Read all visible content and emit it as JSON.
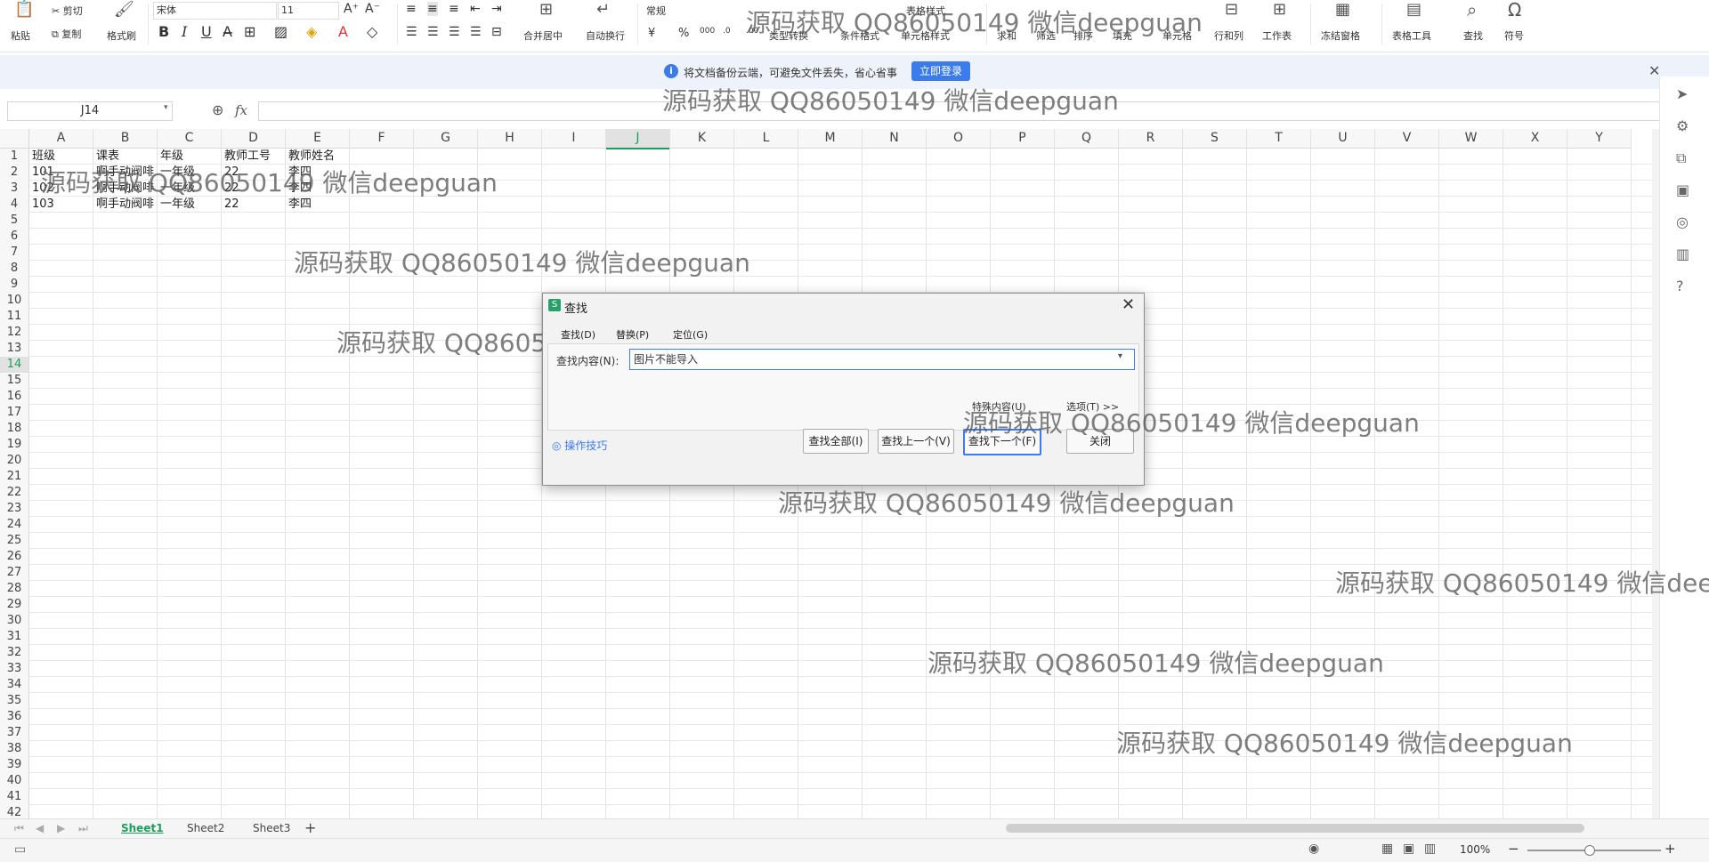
{
  "ribbon": {
    "paste": "粘贴",
    "cut": "剪切",
    "copy": "复制",
    "format_painter": "格式刷",
    "font_name": "宋体",
    "font_size": "11",
    "bold": "B",
    "italic": "I",
    "underline": "U",
    "merge_center": "合并居中",
    "wrap_text": "自动换行",
    "number_format": "常规",
    "currency": "¥",
    "percent": "%",
    "thousands": "000",
    "type_convert": "类型转换",
    "conditional_format": "条件格式",
    "table_style": "表格样式",
    "cell_style": "单元格样式",
    "sum": "求和",
    "filter": "筛选",
    "sort": "排序",
    "fill": "填充",
    "cell": "单元格",
    "row_col": "行和列",
    "worksheet": "工作表",
    "freeze": "冻结窗格",
    "table_tools": "表格工具",
    "find": "查找",
    "symbol": "符号"
  },
  "infobar": {
    "message": "将文档备份云端，可避免文件丢失，省心省事",
    "login_button": "立即登录"
  },
  "formula_bar": {
    "name_box": "J14",
    "fx": "fx"
  },
  "columns": [
    "A",
    "B",
    "C",
    "D",
    "E",
    "F",
    "G",
    "H",
    "I",
    "J",
    "K",
    "L",
    "M",
    "N",
    "O",
    "P",
    "Q",
    "R",
    "S",
    "T",
    "U",
    "V",
    "W",
    "X",
    "Y"
  ],
  "rows": [
    "1",
    "2",
    "3",
    "4",
    "5",
    "6",
    "7",
    "8",
    "9",
    "10",
    "11",
    "12",
    "13",
    "14",
    "15",
    "16",
    "17",
    "18",
    "19",
    "20",
    "21",
    "22",
    "23",
    "24",
    "25",
    "26",
    "27",
    "28",
    "29",
    "30",
    "31",
    "32",
    "33",
    "34",
    "35",
    "36",
    "37",
    "38",
    "39",
    "40",
    "41",
    "42"
  ],
  "cells": [
    [
      "班级",
      "课表",
      "年级",
      "教师工号",
      "教师姓名"
    ],
    [
      "101",
      "啊手动阀啡",
      "一年级",
      "22",
      "李四"
    ],
    [
      "102",
      "啊手动阀啡",
      "一年级",
      "22",
      "李四"
    ],
    [
      "103",
      "啊手动阀啡",
      "一年级",
      "22",
      "李四"
    ]
  ],
  "dialog": {
    "title": "查找",
    "tab_find": "查找(D)",
    "tab_replace": "替换(P)",
    "tab_goto": "定位(G)",
    "find_label": "查找内容(N):",
    "find_value": "图片不能导入",
    "special_content": "特殊内容(U)",
    "options": "选项(T) >>",
    "tips": "操作技巧",
    "find_all": "查找全部(I)",
    "find_prev": "查找上一个(V)",
    "find_next": "查找下一个(F)",
    "close": "关闭"
  },
  "sheets": [
    "Sheet1",
    "Sheet2",
    "Sheet3"
  ],
  "status": {
    "zoom": "100%"
  },
  "watermark": "源码获取 QQ86050149 微信deepguan",
  "colors": {
    "accent": "#3b7bea",
    "sheet_active": "#1e9e5e"
  }
}
